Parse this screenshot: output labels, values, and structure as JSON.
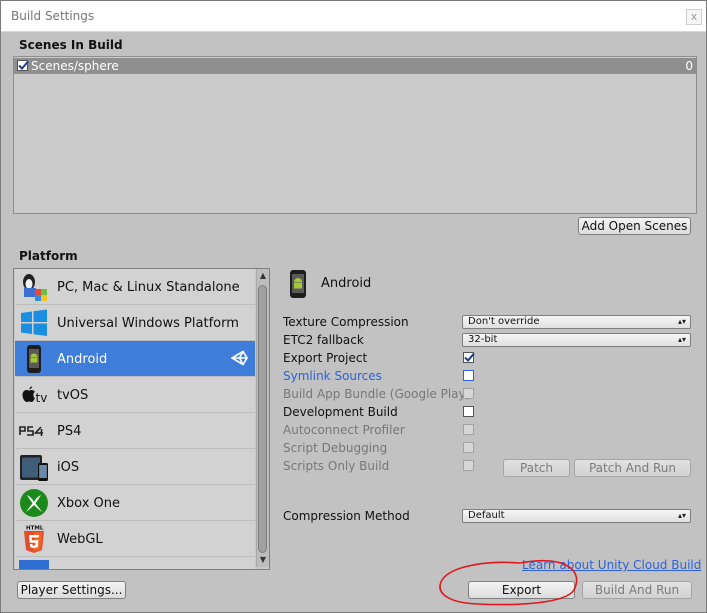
{
  "window": {
    "title": "Build Settings",
    "close_label": "x"
  },
  "scenes": {
    "header": "Scenes In Build",
    "items": [
      {
        "name": "Scenes/sphere",
        "index": "0",
        "checked": true
      }
    ],
    "add_open_scenes_label": "Add Open Scenes"
  },
  "platform": {
    "header": "Platform",
    "items": [
      {
        "label": "PC, Mac & Linux Standalone",
        "icon": "pc-standalone-icon"
      },
      {
        "label": "Universal Windows Platform",
        "icon": "windows-icon"
      },
      {
        "label": "Android",
        "icon": "android-icon",
        "selected": true
      },
      {
        "label": "tvOS",
        "icon": "apple-tv-icon"
      },
      {
        "label": "PS4",
        "icon": "ps4-icon"
      },
      {
        "label": "iOS",
        "icon": "ios-icon"
      },
      {
        "label": "Xbox One",
        "icon": "xbox-icon"
      },
      {
        "label": "WebGL",
        "icon": "html5-icon",
        "badge": "HTML"
      }
    ]
  },
  "android": {
    "title": "Android",
    "texture_compression": {
      "label": "Texture Compression",
      "value": "Don't override"
    },
    "etc2_fallback": {
      "label": "ETC2 fallback",
      "value": "32-bit"
    },
    "export_project": {
      "label": "Export Project",
      "checked": true
    },
    "symlink_sources": {
      "label": "Symlink Sources",
      "checked": false
    },
    "build_app_bundle": {
      "label": "Build App Bundle (Google Play)",
      "checked": false
    },
    "development_build": {
      "label": "Development Build",
      "checked": false
    },
    "autoconnect_profiler": {
      "label": "Autoconnect Profiler",
      "checked": false
    },
    "script_debugging": {
      "label": "Script Debugging",
      "checked": false
    },
    "scripts_only_build": {
      "label": "Scripts Only Build",
      "checked": false
    },
    "patch_label": "Patch",
    "patch_and_run_label": "Patch And Run",
    "compression_method": {
      "label": "Compression Method",
      "value": "Default"
    }
  },
  "footer": {
    "cloud_link": "Learn about Unity Cloud Build",
    "player_settings_label": "Player Settings...",
    "export_label": "Export",
    "build_and_run_label": "Build And Run"
  },
  "colors": {
    "selection": "#3f7ddb",
    "link": "#2e62d6",
    "annotation": "#e0181c"
  }
}
